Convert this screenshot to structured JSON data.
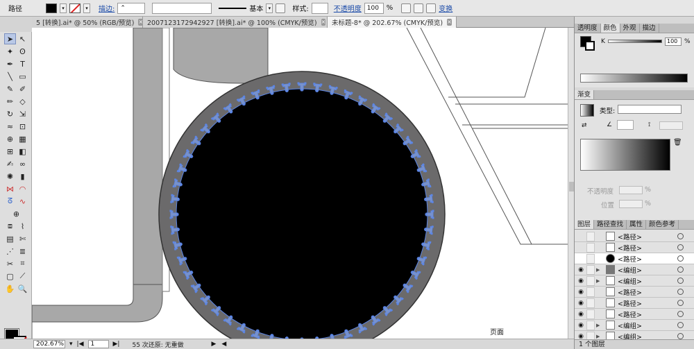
{
  "control_bar": {
    "object_label": "路径",
    "stroke_link": "描边:",
    "stroke_profile": "基本",
    "style_label": "样式:",
    "opacity_link": "不透明度",
    "opacity_value": "100",
    "opacity_unit": "%",
    "transform_link": "变换"
  },
  "tabs": [
    {
      "label": "5 [转换].ai* @ 50% (RGB/预览)"
    },
    {
      "label": "2007123172942927  [转换].ai* @ 100% (CMYK/预览)"
    },
    {
      "label": "未标题-8* @ 202.67% (CMYK/预览)"
    }
  ],
  "status_bar": {
    "zoom": "202.67%",
    "artboard": "1",
    "status_text": "55 次还原: 无重做"
  },
  "canvas": {
    "page_label": "页面",
    "notch_count": 52
  },
  "color_panel": {
    "tabs": [
      "透明度",
      "颜色",
      "外观",
      "描边"
    ],
    "active_tab": 1,
    "channel_label": "K",
    "channel_value": "100",
    "channel_unit": "%"
  },
  "gradient_panel": {
    "title": "渐变",
    "type_label": "类型:",
    "opacity_label": "不透明度",
    "location_label": "位置",
    "percent": "%"
  },
  "layers_panel": {
    "tabs": [
      "图层",
      "路径查找",
      "属性",
      "颜色参考"
    ],
    "rows": [
      {
        "name": "<路径>",
        "thumb": "white",
        "eye": false,
        "expander": ""
      },
      {
        "name": "<路径>",
        "thumb": "white",
        "eye": false,
        "expander": ""
      },
      {
        "name": "<路径>",
        "thumb": "dark",
        "eye": false,
        "expander": "",
        "selected": true
      },
      {
        "name": "<编组>",
        "thumb": "grey",
        "eye": true,
        "expander": "▶"
      },
      {
        "name": "<编组>",
        "thumb": "white",
        "eye": true,
        "expander": "▶"
      },
      {
        "name": "<路径>",
        "thumb": "white",
        "eye": true,
        "expander": ""
      },
      {
        "name": "<路径>",
        "thumb": "white",
        "eye": true,
        "expander": ""
      },
      {
        "name": "<路径>",
        "thumb": "white",
        "eye": true,
        "expander": ""
      },
      {
        "name": "<编组>",
        "thumb": "white",
        "eye": true,
        "expander": "▶"
      },
      {
        "name": "<编组>",
        "thumb": "white",
        "eye": true,
        "expander": "▶"
      }
    ],
    "footer": "1 个图层"
  },
  "colors": {
    "selection_blue": "#5c86e6",
    "ring_grey": "#6b6a6b",
    "accent_link": "#1a4aa8"
  }
}
